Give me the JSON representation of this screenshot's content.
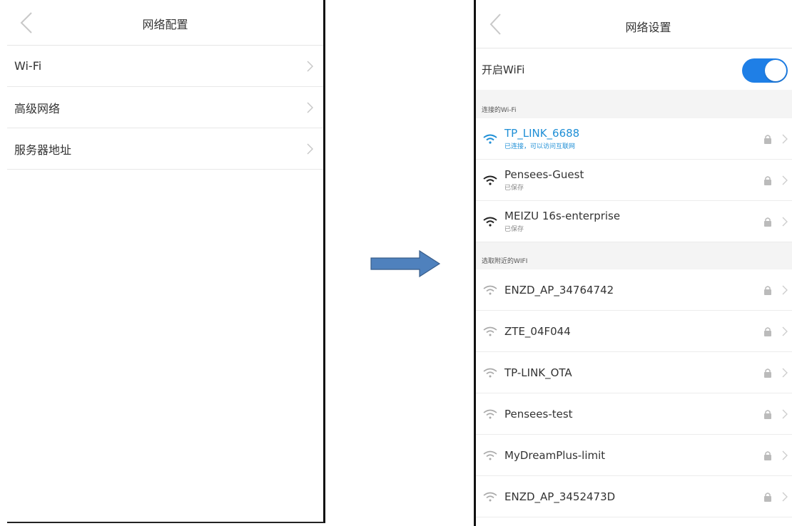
{
  "left": {
    "title": "网络配置",
    "items": [
      {
        "label": "Wi-Fi"
      },
      {
        "label": "高级网络"
      },
      {
        "label": "服务器地址"
      }
    ]
  },
  "right": {
    "title": "网络设置",
    "toggle_label": "开启WiFi",
    "toggle_on": true,
    "connected_section": "连接的Wi-Fi",
    "nearby_section": "选取附近的WIFI",
    "connected": [
      {
        "name": "TP_LINK_6688",
        "status": "已连接，可以访问互联网",
        "active": true
      },
      {
        "name": "Pensees-Guest",
        "status": "已保存",
        "active": false
      },
      {
        "name": "MEIZU 16s-enterprise",
        "status": "已保存",
        "active": false
      }
    ],
    "nearby": [
      {
        "name": "ENZD_AP_34764742"
      },
      {
        "name": "ZTE_04F044"
      },
      {
        "name": "TP-LINK_OTA"
      },
      {
        "name": "Pensees-test"
      },
      {
        "name": "MyDreamPlus-limit"
      },
      {
        "name": "ENZD_AP_3452473D"
      }
    ]
  },
  "colors": {
    "accent": "#1f7fe6",
    "connected_text": "#1f8fd6",
    "arrow": "#4f81bd"
  }
}
